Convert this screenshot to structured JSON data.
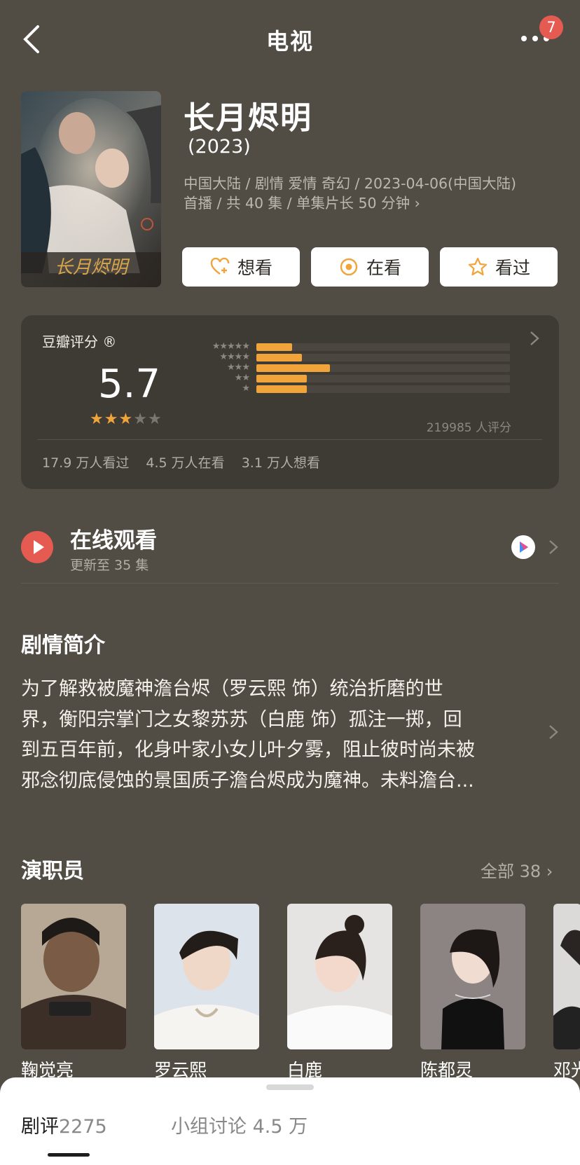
{
  "header": {
    "title": "电视",
    "badge_count": "7"
  },
  "movie": {
    "title": "长月烬明",
    "year": "(2023)",
    "meta_line1": "中国大陆 / 剧情 爱情 奇幻 / 2023-04-06(中国大陆)",
    "meta_line2": "首播 / 共 40 集 / 单集片长 50 分钟",
    "poster_text": "长月烬明"
  },
  "actions": [
    {
      "label": "想看",
      "icon": "heart-plus-icon"
    },
    {
      "label": "在看",
      "icon": "target-icon"
    },
    {
      "label": "看过",
      "icon": "star-icon"
    }
  ],
  "rating": {
    "label": "豆瓣评分 ®",
    "score": "5.7",
    "stars": 3,
    "distribution": [
      {
        "stars": 5,
        "fraction": 0.14
      },
      {
        "stars": 4,
        "fraction": 0.18
      },
      {
        "stars": 3,
        "fraction": 0.29
      },
      {
        "stars": 2,
        "fraction": 0.2
      },
      {
        "stars": 1,
        "fraction": 0.2
      }
    ],
    "total": "219985 人评分",
    "watched": "17.9 万人看过",
    "watching": "4.5 万人在看",
    "want": "3.1 万人想看",
    "colors": {
      "accent": "#f0a43a",
      "card": "#3e3a34"
    }
  },
  "watch": {
    "title": "在线观看",
    "subtitle": "更新至 35 集",
    "provider_icon": "youku-logo"
  },
  "synopsis": {
    "title": "剧情简介",
    "lines": [
      "为了解救被魔神澹台烬（罗云熙 饰）统治折磨的世",
      "界，衡阳宗掌门之女黎苏苏（白鹿 饰）孤注一掷，回",
      "到五百年前，化身叶家小女儿叶夕雾，阻止彼时尚未被",
      "邪念彻底侵蚀的景国质子澹台烬成为魔神。未料澹台..."
    ]
  },
  "cast": {
    "title": "演职员",
    "all_label": "全部 38",
    "members": [
      {
        "name": "鞠觉亮"
      },
      {
        "name": "罗云熙"
      },
      {
        "name": "白鹿"
      },
      {
        "name": "陈都灵"
      },
      {
        "name": "邓光"
      }
    ]
  },
  "bottom": {
    "tab1_label": "剧评",
    "tab1_count": "2275",
    "tab2_label": "小组讨论 4.5 万"
  }
}
